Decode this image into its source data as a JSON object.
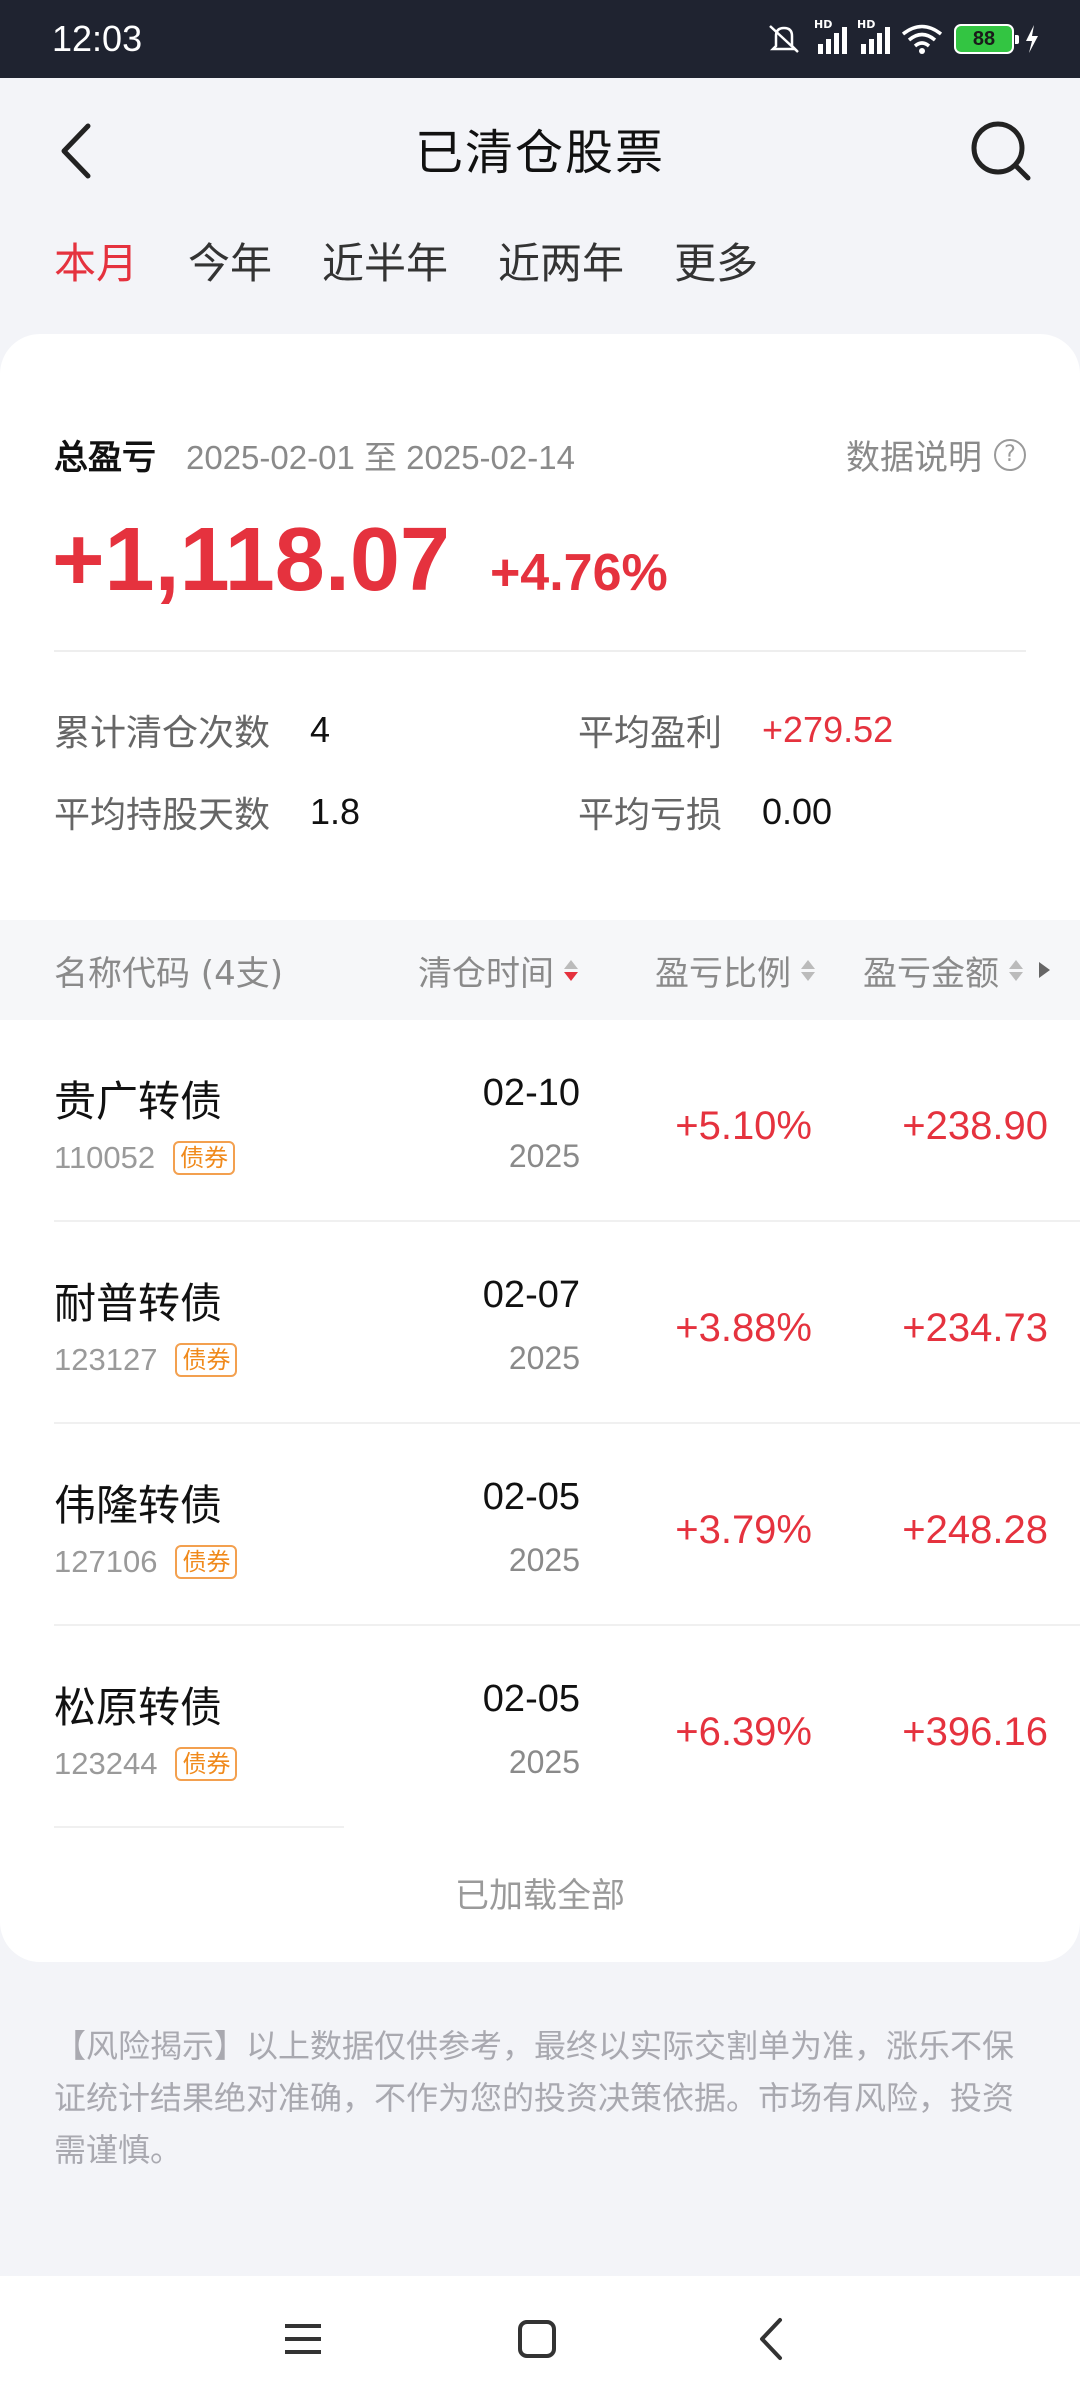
{
  "status_bar": {
    "time": "12:03",
    "battery": "88",
    "hd1": "HD",
    "hd2": "HD"
  },
  "header": {
    "title": "已清仓股票"
  },
  "tabs": [
    "本月",
    "今年",
    "近半年",
    "近两年",
    "更多"
  ],
  "summary": {
    "label": "总盈亏",
    "date_range": "2025-02-01 至 2025-02-14",
    "data_note": "数据说明",
    "help_glyph": "?",
    "total_amount": "+1,118.07",
    "total_pct": "+4.76%"
  },
  "stats": {
    "clear_count_label": "累计清仓次数",
    "clear_count": "4",
    "avg_profit_label": "平均盈利",
    "avg_profit": "+279.52",
    "avg_days_label": "平均持股天数",
    "avg_days": "1.8",
    "avg_loss_label": "平均亏损",
    "avg_loss": "0.00"
  },
  "table": {
    "headers": {
      "name": "名称代码 (4支)",
      "time": "清仓时间",
      "pct": "盈亏比例",
      "amount": "盈亏金额"
    },
    "rows": [
      {
        "name": "贵广转债",
        "code": "110052",
        "tag": "债券",
        "date": "02-10",
        "year": "2025",
        "pct": "+5.10%",
        "amount": "+238.90"
      },
      {
        "name": "耐普转债",
        "code": "123127",
        "tag": "债券",
        "date": "02-07",
        "year": "2025",
        "pct": "+3.88%",
        "amount": "+234.73"
      },
      {
        "name": "伟隆转债",
        "code": "127106",
        "tag": "债券",
        "date": "02-05",
        "year": "2025",
        "pct": "+3.79%",
        "amount": "+248.28"
      },
      {
        "name": "松原转债",
        "code": "123244",
        "tag": "债券",
        "date": "02-05",
        "year": "2025",
        "pct": "+6.39%",
        "amount": "+396.16"
      }
    ],
    "loaded_all": "已加载全部"
  },
  "disclaimer": "【风险揭示】以上数据仅供参考，最终以实际交割单为准，涨乐不保证统计结果绝对准确，不作为您的投资决策依据。市场有风险，投资需谨慎。",
  "colors": {
    "accent": "#e5323e",
    "tag": "#f08a1c",
    "status_bar": "#1f2330"
  },
  "icons": [
    "back-arrow-icon",
    "search-icon",
    "help-icon",
    "sort-icon",
    "menu-icon",
    "home-icon",
    "nav-back-icon"
  ]
}
